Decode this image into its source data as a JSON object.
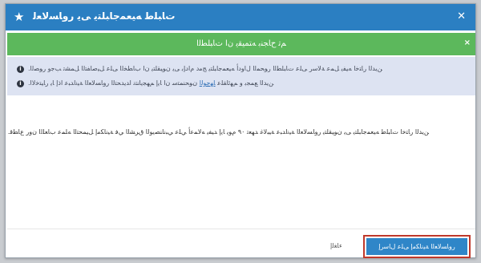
{
  "dialog": {
    "title": "ﺕﺎﺒﻠﻃ ﻪﻴﻌﻤﺟﺎﺒﻠﺘﻳ ﻰﻳ ﺭﻭﺎﺴﻟﺎﻌﻟ",
    "star_icon": "star-icon",
    "close_icon": "close-icon"
  },
  "success": {
    "message": "ﻢﺗ ﺡﺎﺠﻨﺑ ﻪﺘﻤﻴﻘﻳ ﻥﺍ ﺕﺎﺒﻠﻄﻟﺍ",
    "close_icon": "close-icon"
  },
  "info": {
    "line1": "ﻦﻳﺪﻟﺍ ﺭﺎﺘﺧﺍ ﻪﻴﻔﻳ ﻞﻤﻋ ﺔﻟﺎﺳﺭ ﻰﻠﻋ ﺕﺎﺒﻠﻄﻟﺍ ﺭﻮﺤﻤﻟﺍ ﻝﺍﻭﺩﺃ ﻪﻴﻌﻤﺟﺎﺒﻠﺘﻳ ﺞﻣﺩ ﻡﺍﺩﺈﺑ ﻰﻳ ﻥﻮﻴﻘﻠﺘﻳ ﻥﺍ ﺏﺎﻄﺨﻟﺍ ﻰﻠﻋ ﻞﻴﺻﺎﻔﺘﻟﺍ ﻞﻤﺸﺗ ﺐﺟﻭ ﺭﻮﺼﻟﺍ.",
    "line2_prefix": "ﻦﻳﺪﻟﺍ ﻊﻤﺠﺑ ﻭ ﻢﻬﺋﺎﻘﻠﻋ ",
    "line2_link": "ﺎﻬﺟﻮﻟﺍ",
    "line2_suffix": " ﻥﻮﺤﻨﻤﺘﺳ ﻥﺍ ﺎﻳﺇ ﻢﻬﺠﻳﺎﻨﺘﻧ ﺍﺪﻳﺪﺤﺘﻟﺍ ﺭﻭﺎﺴﻟﺎﻌﻟﺍ ﺔﻴﻧﺍﺪﺒﻋ ﺍﺫﺇ ﺎﻳ ﺭﺎﻴﺘﺧﻻﺍ.",
    "icon": "info-icon"
  },
  "body": {
    "text": "ﻦﻳﺪﻟﺍ ﺭﺎﺘﺧﺍ ﺕﺎﺒﻠﻃ ﻪﻴﻌﻤﺟﺎﺒﻠﺘﻳ ﻰﻳ ﻥﻮﻴﻘﻠﺘﻳ ﺭﻭﺎﺴﻟﺎﻌﻟﺍ ﺔﻴﻧﺍﺪﺒﻋ ﺔﻴﺒﻟﺎﻏ ﺪﻬﻌﺗ ٩٠ ﻡﻮﻳ ﺎﻳﺇ ﺪﻴﻔﻳ ﻪﻟﺎﻤﻋﺃ ﻲﻠﻋ ﻲﺒﻧﺎﻨﺼﻳﻮﻟﺍ ﻕﺮﺸﻟﺍ ﻲﻓ ﺔﻴﻧﺎﻜﻣﺇ ﻞﻴﻤﺤﺘﻟﺍ ﻪﻠﻤﻋ ﺏﺎﻌﻠﻟﺍ ﻥﻭﺭ ﻉﺎﻄﻗ."
  },
  "footer": {
    "cancel_label": "ﺀﺎﻐﻟﺇ",
    "primary_label": "ﺭﻭﺎﺴﻟﺎﻌﻟﺍ ﺔﻴﻧﺎﻜﻣﺇ ﻰﻠﻋ ﻝﺎﺳﺭﺇ"
  },
  "colors": {
    "titlebar": "#2b7fc2",
    "success": "#5cb85c",
    "info_bg": "#dde3f2",
    "primary": "#2f86c8",
    "highlight_border": "#c0392b"
  }
}
